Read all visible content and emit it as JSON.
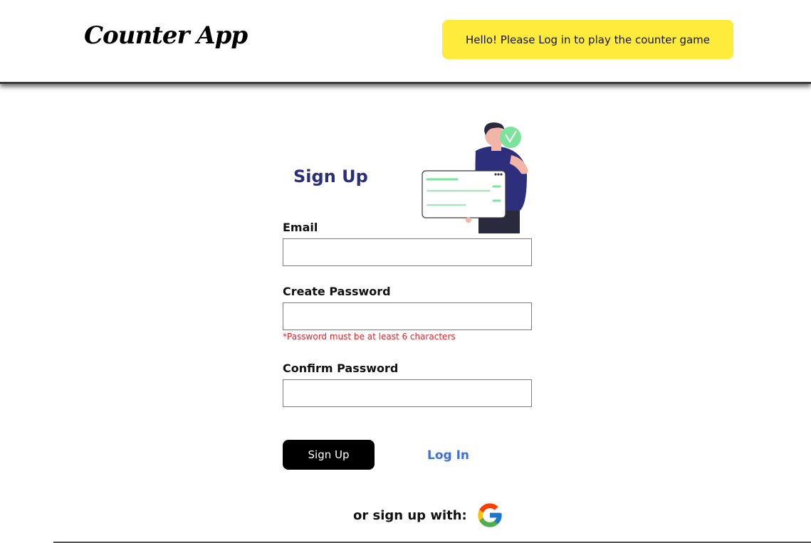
{
  "header": {
    "logo_text": "Counter App",
    "greeting": "Hello! Please Log in to play the counter game"
  },
  "form": {
    "title": "Sign Up",
    "fields": [
      {
        "label": "Email",
        "value": ""
      },
      {
        "label": "Create Password",
        "value": ""
      },
      {
        "label": "Confirm Password",
        "value": ""
      }
    ],
    "password_hint": "*Password must be at least 6 characters",
    "submit_label": "Sign Up",
    "login_link": "Log In",
    "alt_signup_text": "or sign up with:",
    "alt_provider_icon": "google-icon"
  },
  "colors": {
    "greeting_bg": "#ffeb3b",
    "title": "#2b2f7a",
    "link": "#3f6fd8",
    "hint": "#e0252b",
    "button_bg": "#000000",
    "illustration_shirt": "#2e2f7c",
    "illustration_check": "#7be39b"
  }
}
